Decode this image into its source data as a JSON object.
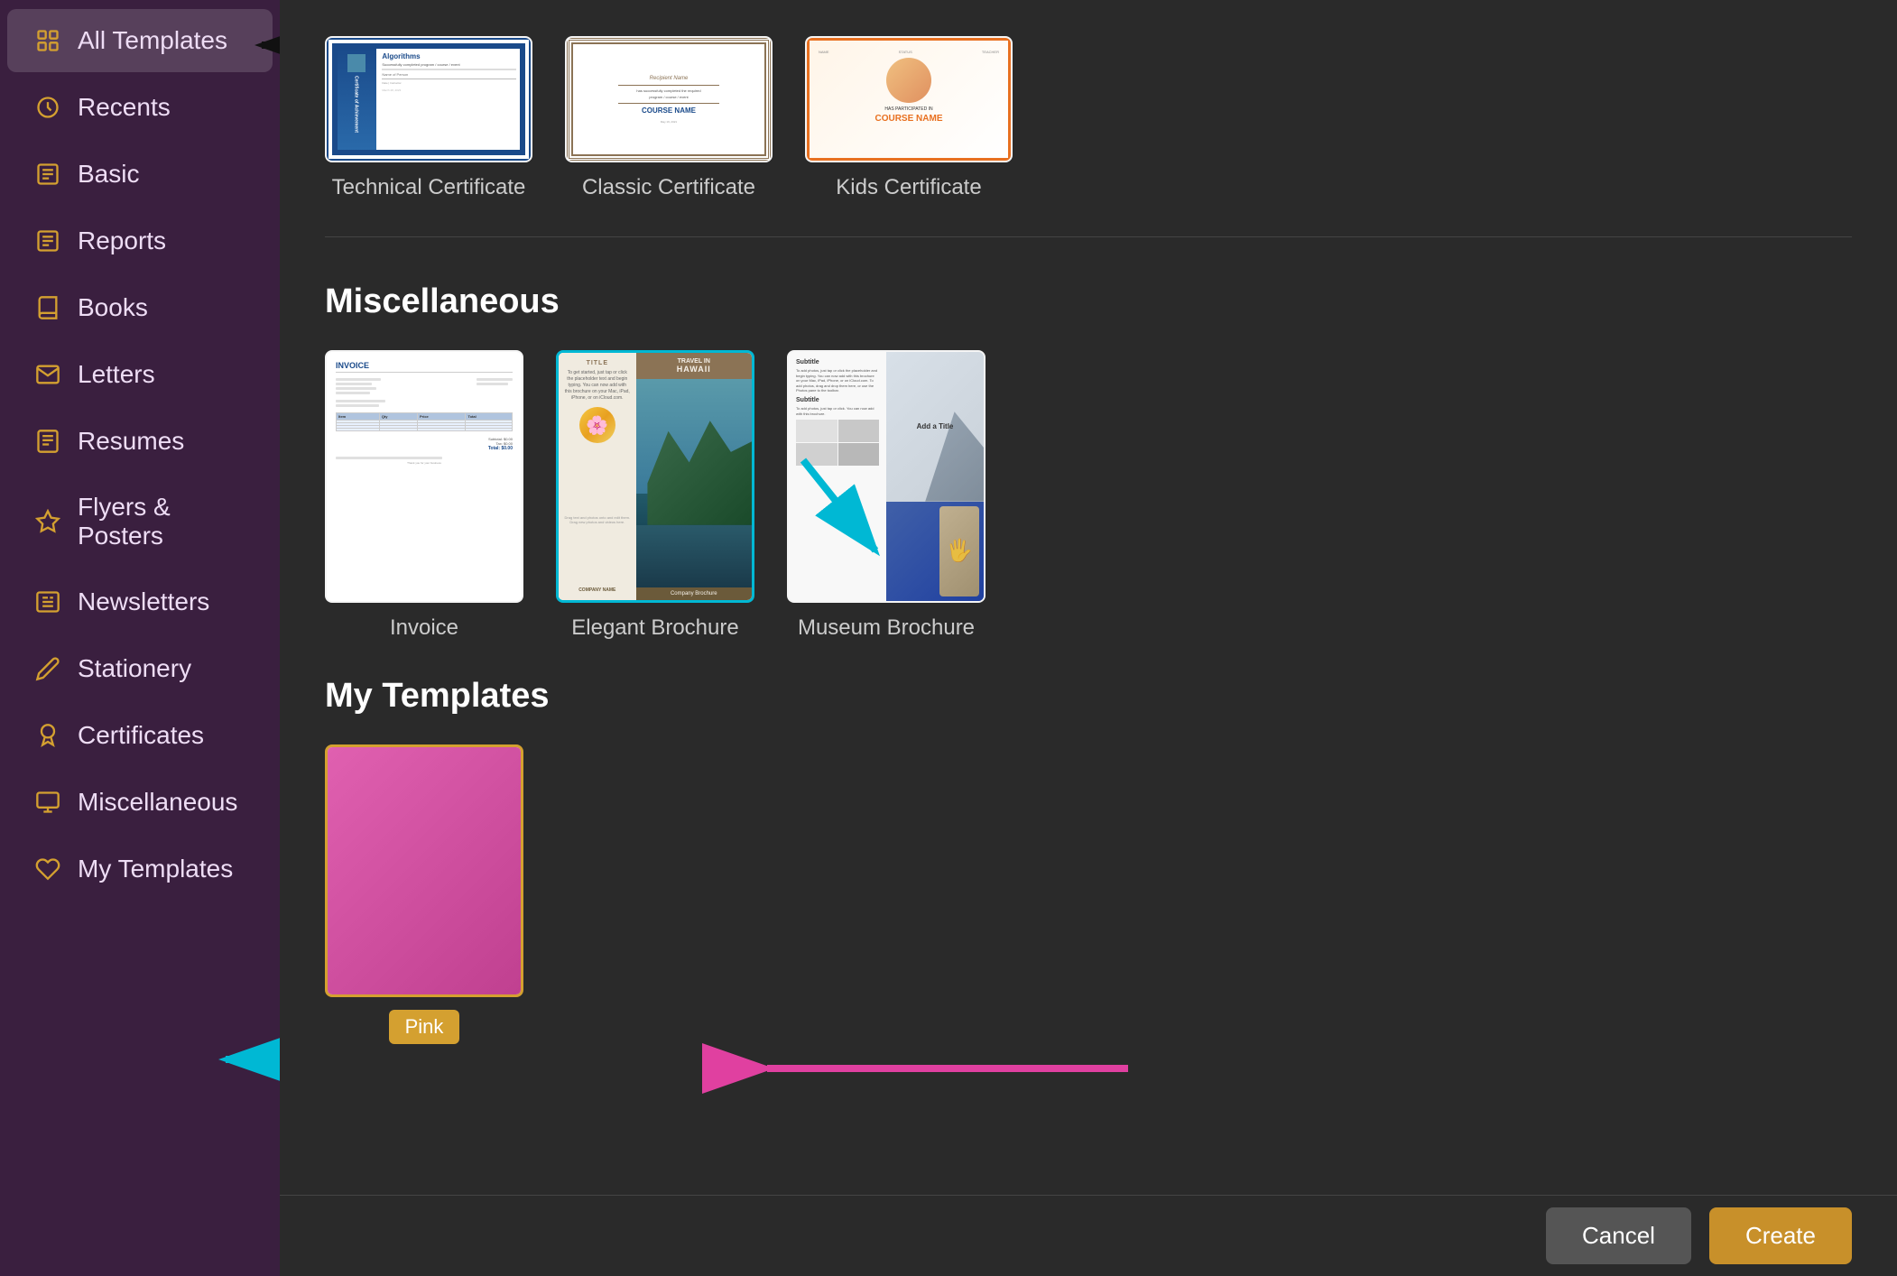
{
  "sidebar": {
    "items": [
      {
        "id": "all-templates",
        "label": "All Templates",
        "icon": "⊞",
        "active": true
      },
      {
        "id": "recents",
        "label": "Recents",
        "icon": "⏱"
      },
      {
        "id": "basic",
        "label": "Basic",
        "icon": "≡"
      },
      {
        "id": "reports",
        "label": "Reports",
        "icon": "📋"
      },
      {
        "id": "books",
        "label": "Books",
        "icon": "📖"
      },
      {
        "id": "letters",
        "label": "Letters",
        "icon": "✉"
      },
      {
        "id": "resumes",
        "label": "Resumes",
        "icon": "📄"
      },
      {
        "id": "flyers-posters",
        "label": "Flyers & Posters",
        "icon": "📌"
      },
      {
        "id": "newsletters",
        "label": "Newsletters",
        "icon": "📰"
      },
      {
        "id": "stationery",
        "label": "Stationery",
        "icon": "✏"
      },
      {
        "id": "certificates",
        "label": "Certificates",
        "icon": "🏅"
      },
      {
        "id": "miscellaneous",
        "label": "Miscellaneous",
        "icon": "🗂"
      },
      {
        "id": "my-templates",
        "label": "My Templates",
        "icon": "♡"
      }
    ]
  },
  "sections": {
    "certificates": {
      "cards": [
        {
          "label": "Technical Certificate"
        },
        {
          "label": "Classic Certificate"
        },
        {
          "label": "Kids Certificate"
        }
      ]
    },
    "miscellaneous": {
      "title": "Miscellaneous",
      "cards": [
        {
          "label": "Invoice"
        },
        {
          "label": "Elegant Brochure"
        },
        {
          "label": "Museum Brochure"
        }
      ]
    },
    "my_templates": {
      "title": "My Templates",
      "cards": [
        {
          "label": "Pink"
        }
      ]
    }
  },
  "buttons": {
    "cancel": "Cancel",
    "create": "Create"
  }
}
